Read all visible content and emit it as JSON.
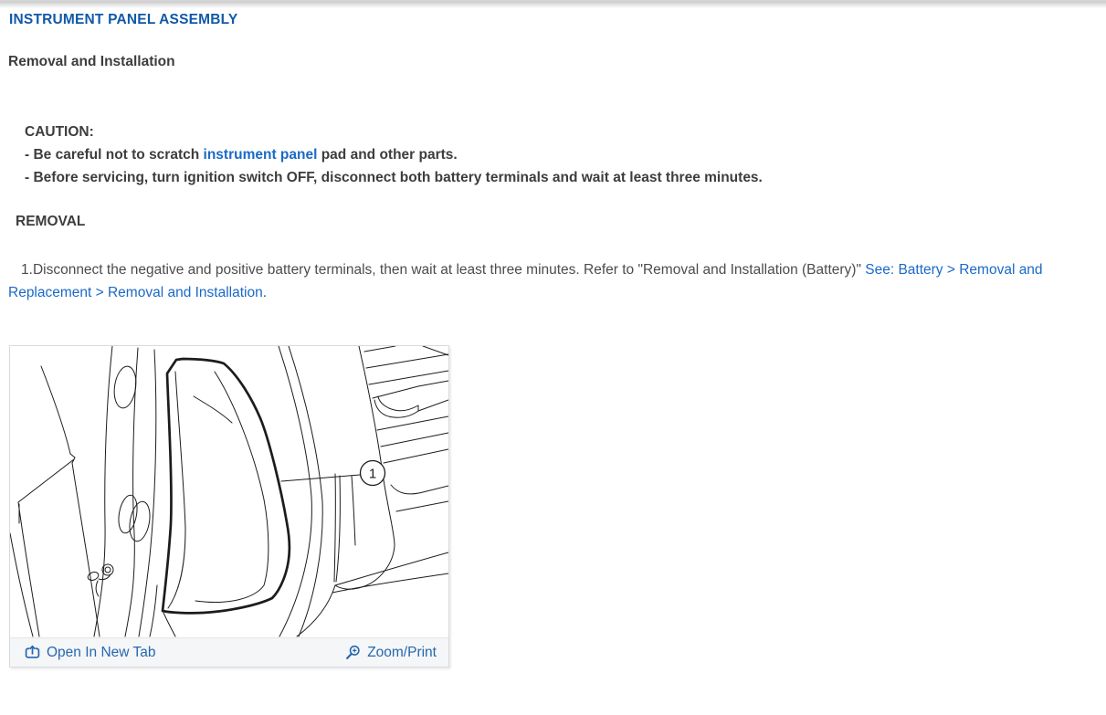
{
  "page": {
    "title": "INSTRUMENT PANEL ASSEMBLY",
    "subtitle": "Removal and Installation"
  },
  "caution": {
    "label": "CAUTION:",
    "line1_pre": "- Be careful not to scratch ",
    "line1_link": "instrument panel",
    "line1_post": " pad and other parts.",
    "line2": "- Before servicing, turn ignition switch OFF, disconnect both battery terminals and wait at least three minutes."
  },
  "removal": {
    "heading": "REMOVAL",
    "step_number": "1.",
    "step_text": "Disconnect the negative and positive battery terminals, then wait at least three minutes. Refer to \"Removal and Installation (Battery)\" ",
    "step_link": "See: Battery > Removal and Replacement > Removal and Installation",
    "step_suffix": "."
  },
  "figure": {
    "callout_number": "1",
    "open_in_new_tab_label": "Open In New Tab",
    "zoom_print_label": "Zoom/Print"
  },
  "colors": {
    "title_blue": "#1159a8",
    "inline_link_blue": "#1a69c7",
    "footer_link_blue": "#2767ae",
    "heading_text": "#3d3d3d",
    "body_text": "#4c4c4c",
    "footer_bg": "#f4f6f8",
    "panel_border": "#d8dbdd"
  }
}
